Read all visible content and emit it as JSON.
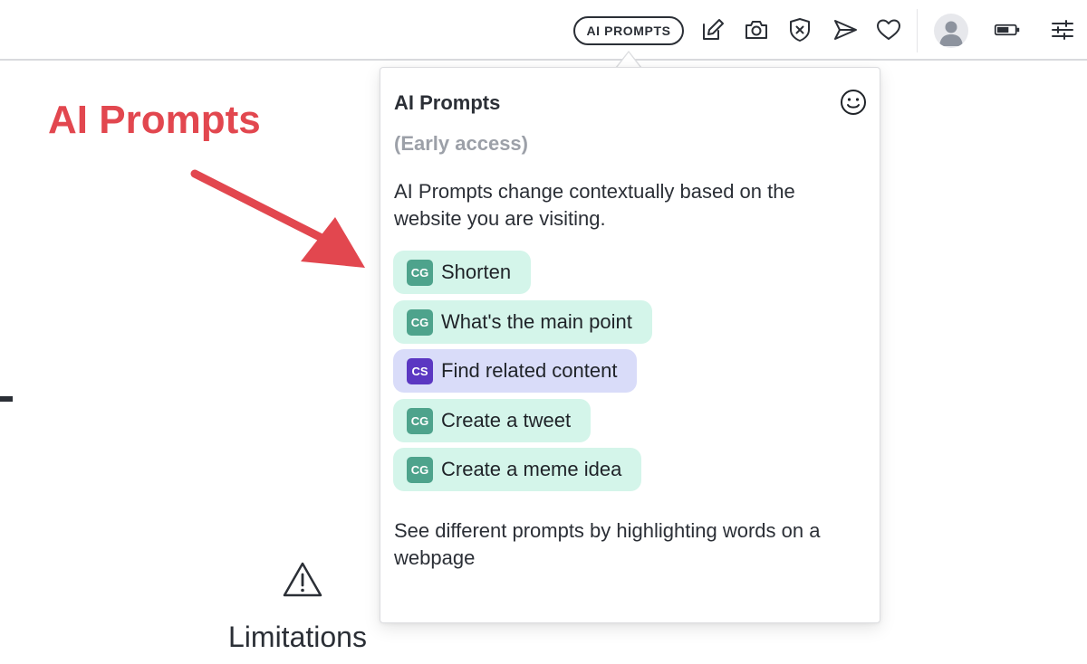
{
  "toolbar": {
    "ai_prompts_button": "AI PROMPTS",
    "icons": [
      "edit-icon",
      "camera-icon",
      "shield-x-icon",
      "send-icon",
      "heart-icon",
      "avatar",
      "battery-icon",
      "sliders-icon"
    ]
  },
  "background": {
    "annotation_title": "AI Prompts",
    "limitations_label": "Limitations",
    "accent_color": "#e2474f"
  },
  "popover": {
    "title": "AI Prompts",
    "subtitle": "(Early access)",
    "description": "AI Prompts change contextually based on the website you are visiting.",
    "prompts": [
      {
        "badge": "CG",
        "label": "Shorten",
        "kind": "cg"
      },
      {
        "badge": "CG",
        "label": "What's the main point",
        "kind": "cg"
      },
      {
        "badge": "CS",
        "label": "Find related content",
        "kind": "cs"
      },
      {
        "badge": "CG",
        "label": "Create a tweet",
        "kind": "cg"
      },
      {
        "badge": "CG",
        "label": "Create a meme idea",
        "kind": "cg"
      }
    ],
    "footer": "See different prompts by highlighting words on a webpage",
    "colors": {
      "cg_bg": "#d4f5ea",
      "cg_badge": "#4ea38c",
      "cs_bg": "#d9dcf9",
      "cs_badge": "#5b37c2"
    }
  }
}
